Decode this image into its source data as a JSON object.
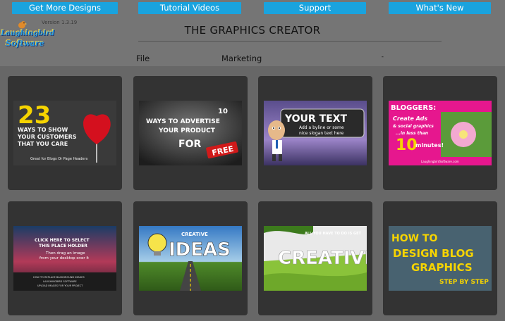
{
  "top_nav": [
    {
      "label": "Get More Designs"
    },
    {
      "label": "Tutorial Videos"
    },
    {
      "label": "Support"
    },
    {
      "label": "What's New"
    }
  ],
  "header": {
    "logo_line1": "Laughingbird",
    "logo_line2": "Software",
    "version": "Version 1.3.19",
    "title": "THE GRAPHICS CREATOR"
  },
  "menu": {
    "file": "File",
    "category": "Marketing",
    "category_arrow": "-"
  },
  "templates": [
    {
      "big": "23",
      "lines": [
        "WAYS TO SHOW",
        "YOUR CUSTOMERS",
        "THAT YOU CARE"
      ],
      "sub": "Great for Blogs Or Page Headers"
    },
    {
      "number": "10",
      "lines": [
        "WAYS TO ADVERTISE",
        "YOUR PRODUCT"
      ],
      "for": "FOR",
      "tag": "FREE"
    },
    {
      "headline": "YOUR TEXT",
      "sub1": "Add a byline or some",
      "sub2": "nice slogan text here"
    },
    {
      "brand": "BLOGGERS:",
      "lines": [
        "Create Ads",
        "& social graphics",
        "...in less than"
      ],
      "big": "10",
      "unit": "minutes!",
      "footer": "LaughingbirdSoftware.com"
    },
    {
      "line1": "CLICK HERE TO SELECT",
      "line2": "THIS PLACE HOLDER",
      "line3": "Then drag an image",
      "line4": "from your desktop over it",
      "footer1": "HOW TO REPLACE BACKGROUND IMAGES",
      "footer2": "LAUGHINGBIRD SOFTWARE",
      "footer3": "UPLOAD IMAGES FOR YOUR PROJECT"
    },
    {
      "small": "CREATIVE",
      "big": "IDEAS"
    },
    {
      "small": "ALL YOU HAVE TO DO IS GET",
      "big": "CREATIVE"
    },
    {
      "line1": "HOW TO",
      "line2": "DESIGN BLOG",
      "line3": "GRAPHICS",
      "line4": "STEP BY STEP"
    }
  ],
  "colors": {
    "accent": "#1aa3de",
    "background": "#757575",
    "grid": "#676767",
    "card": "#333333"
  }
}
